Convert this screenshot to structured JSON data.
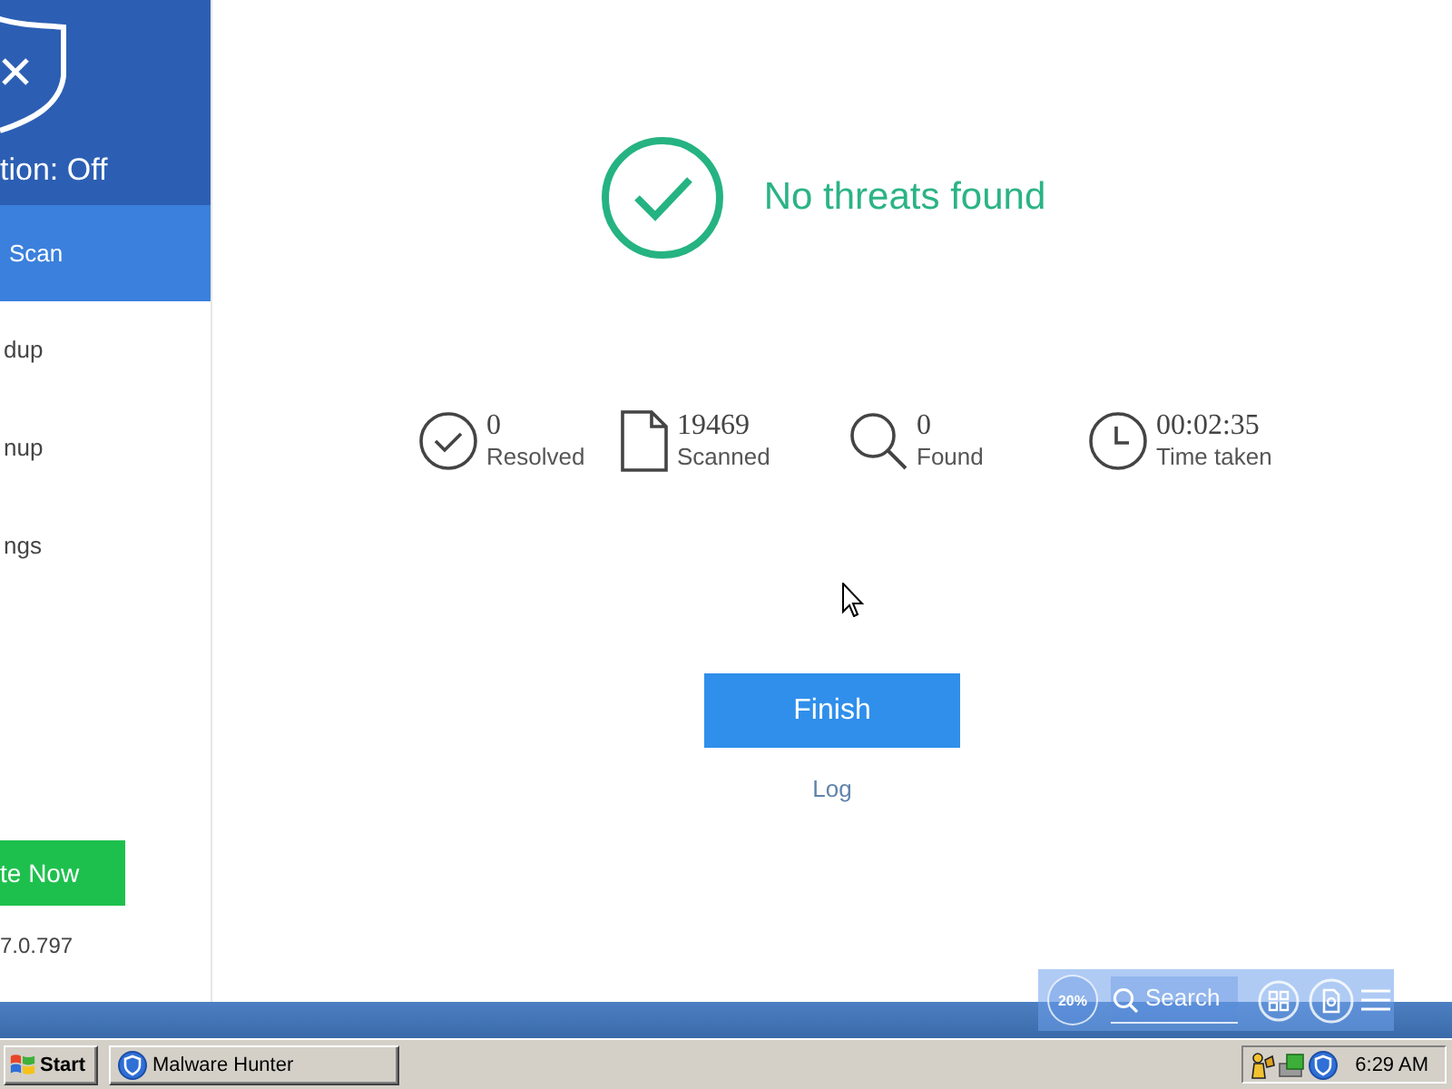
{
  "sidebar": {
    "status": "tion: Off",
    "items": [
      {
        "label": "Scan",
        "selected": true
      },
      {
        "label": "dup",
        "selected": false
      },
      {
        "label": "nup",
        "selected": false
      },
      {
        "label": "ngs",
        "selected": false
      }
    ],
    "update_button": "te Now",
    "version": "7.0.797"
  },
  "result": {
    "title": "No threats found"
  },
  "stats": [
    {
      "kind": "resolved",
      "value": "0",
      "label": "Resolved"
    },
    {
      "kind": "scanned",
      "value": "19469",
      "label": "Scanned"
    },
    {
      "kind": "found",
      "value": "0",
      "label": "Found"
    },
    {
      "kind": "time",
      "value": "00:02:35",
      "label": "Time taken"
    }
  ],
  "finish_button": "Finish",
  "log_link": "Log",
  "floating_toolbar": {
    "badge": "20%",
    "search_placeholder": "Search"
  },
  "taskbar": {
    "start": "Start",
    "windows": [
      {
        "label": "Malware Hunter",
        "selected": false
      }
    ],
    "clock": "6:29 AM"
  }
}
